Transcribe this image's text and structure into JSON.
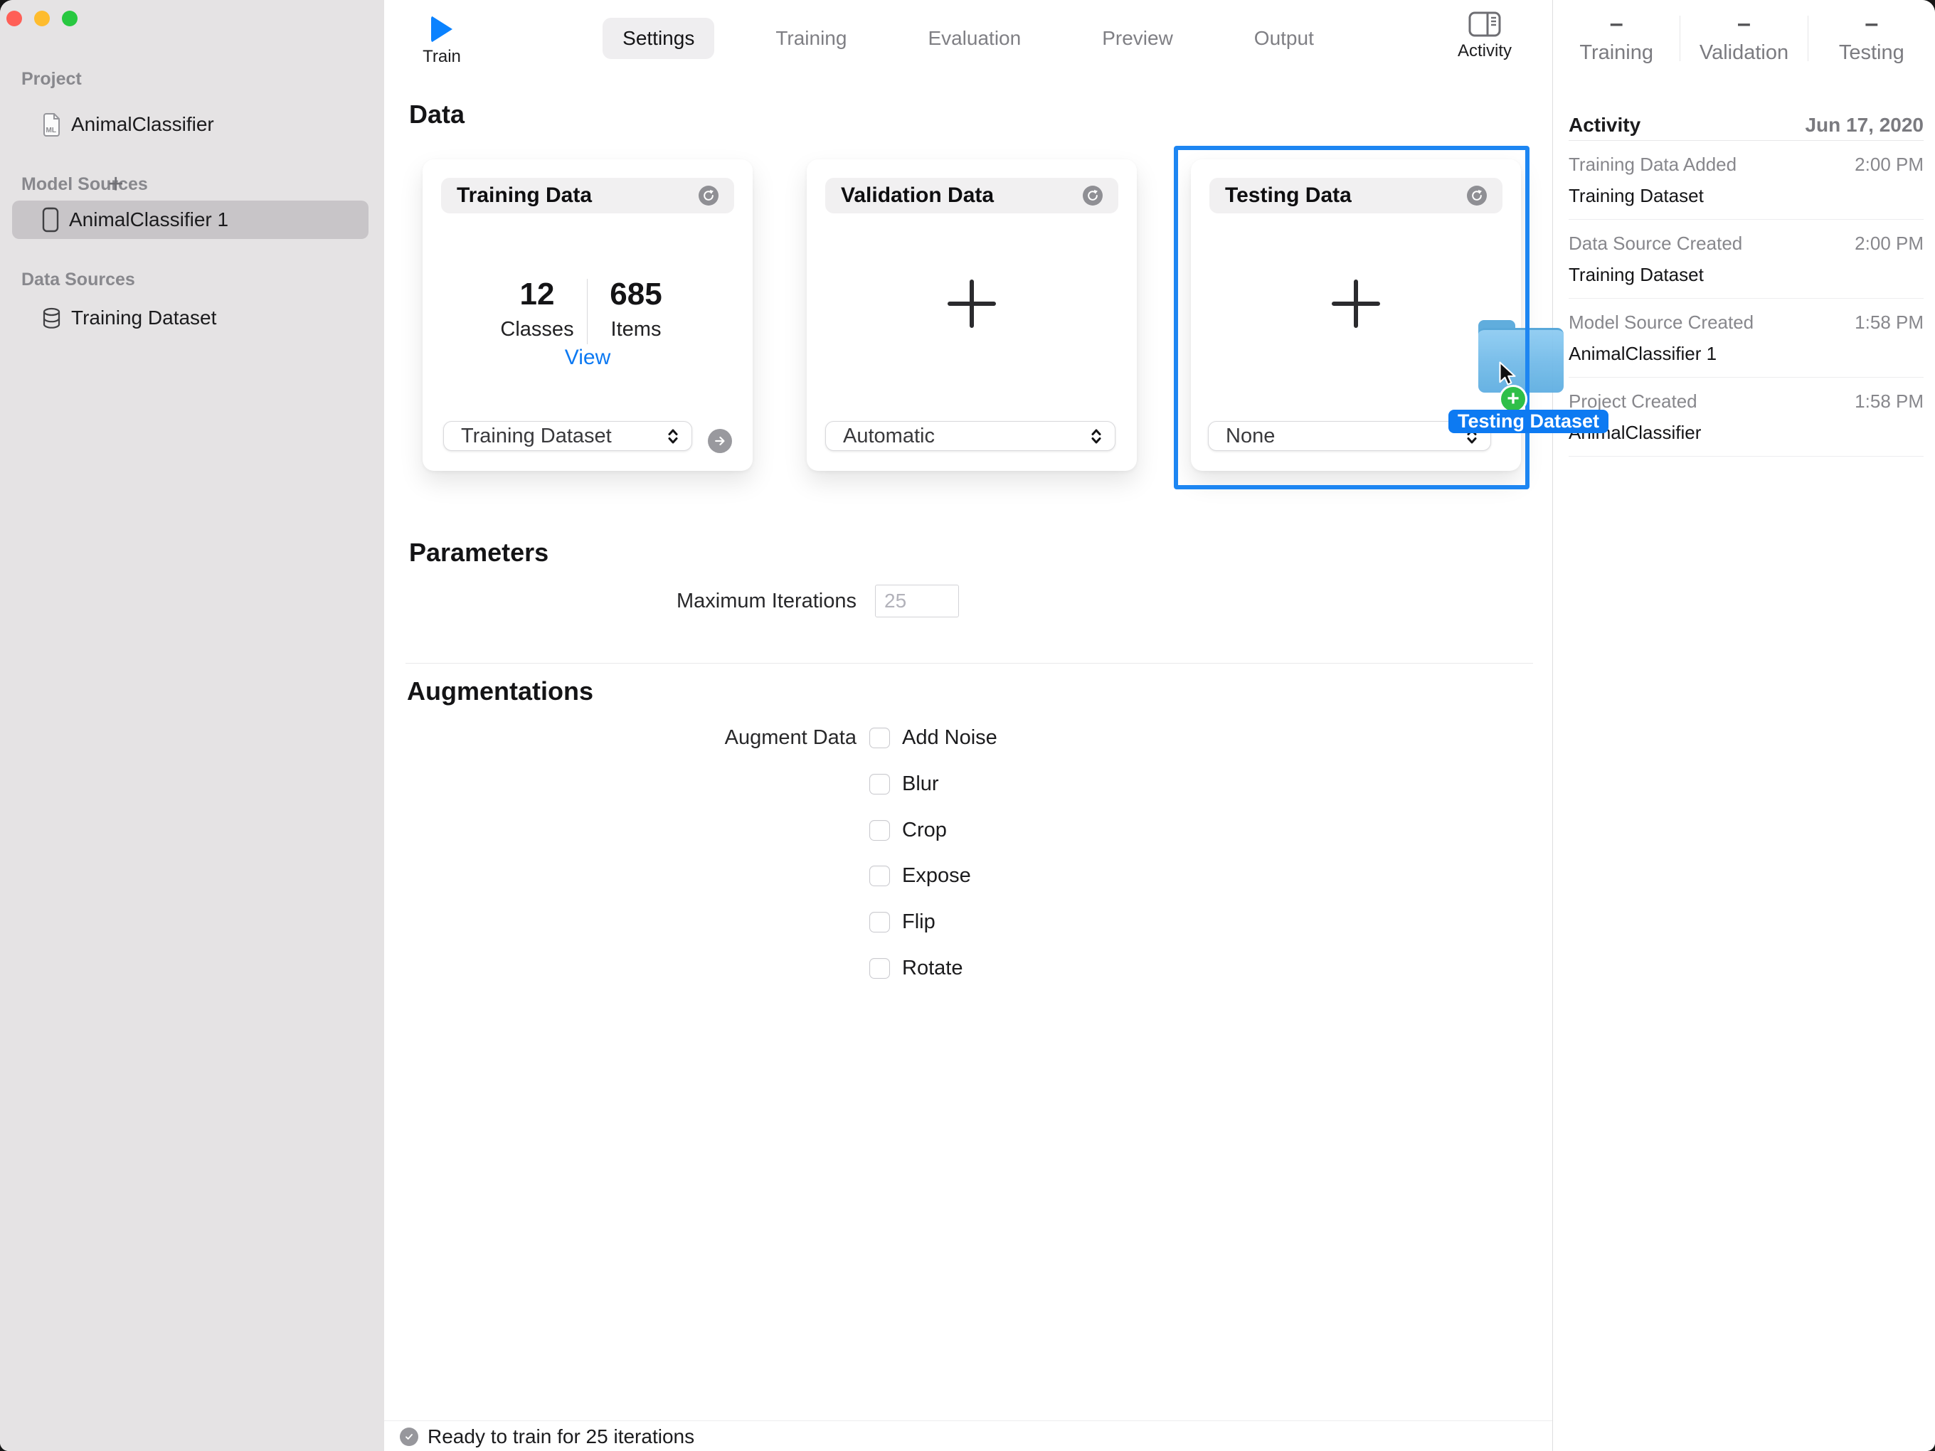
{
  "sidebar": {
    "project_label": "Project",
    "project_item": "AnimalClassifier",
    "model_sources_label": "Model Sources",
    "add_button": "+",
    "model_item": "AnimalClassifier 1",
    "data_sources_label": "Data Sources",
    "data_item": "Training Dataset"
  },
  "toolbar": {
    "train_label": "Train",
    "tabs": [
      {
        "label": "Settings",
        "active": true
      },
      {
        "label": "Training",
        "active": false
      },
      {
        "label": "Evaluation",
        "active": false
      },
      {
        "label": "Preview",
        "active": false
      },
      {
        "label": "Output",
        "active": false
      }
    ],
    "activity_label": "Activity"
  },
  "data_section": {
    "title": "Data",
    "training_card": {
      "title": "Training Data",
      "classes_value": "12",
      "classes_label": "Classes",
      "items_value": "685",
      "items_label": "Items",
      "view_label": "View",
      "source": "Training Dataset"
    },
    "validation_card": {
      "title": "Validation Data",
      "source": "Automatic"
    },
    "testing_card": {
      "title": "Testing Data",
      "source": "None"
    }
  },
  "parameters": {
    "title": "Parameters",
    "max_iterations_label": "Maximum Iterations",
    "max_iterations_value": "25"
  },
  "augmentations": {
    "title": "Augmentations",
    "augment_label": "Augment Data",
    "options": [
      "Add Noise",
      "Blur",
      "Crop",
      "Expose",
      "Flip",
      "Rotate"
    ],
    "checked": [
      false,
      false,
      false,
      false,
      false,
      false
    ]
  },
  "status_bar": {
    "message": "Ready to train for 25 iterations"
  },
  "activity_panel": {
    "stats": [
      {
        "value": "–",
        "label": "Training"
      },
      {
        "value": "–",
        "label": "Validation"
      },
      {
        "value": "–",
        "label": "Testing"
      }
    ],
    "header_title": "Activity",
    "header_date": "Jun 17, 2020",
    "events": [
      {
        "title": "Training Data Added",
        "time": "2:00 PM",
        "subject": "Training Dataset"
      },
      {
        "title": "Data Source Created",
        "time": "2:00 PM",
        "subject": "Training Dataset"
      },
      {
        "title": "Model Source Created",
        "time": "1:58 PM",
        "subject": "AnimalClassifier 1"
      },
      {
        "title": "Project Created",
        "time": "1:58 PM",
        "subject": "AnimalClassifier"
      }
    ]
  },
  "drag": {
    "plus_symbol": "+",
    "badge_label": "Testing Dataset"
  },
  "colors": {
    "accent_blue": "#0a82ff",
    "link_blue": "#0c79f2",
    "drop_ring_blue": "#1d86f2",
    "drag_label_blue": "#0d7af2",
    "badge_green": "#2fbf49",
    "folder_blue": "#6fb9e8",
    "sidebar_bg": "#e5e3e4",
    "selected_row": "#c8c5c8",
    "pill_bg": "#f1f0f1"
  }
}
